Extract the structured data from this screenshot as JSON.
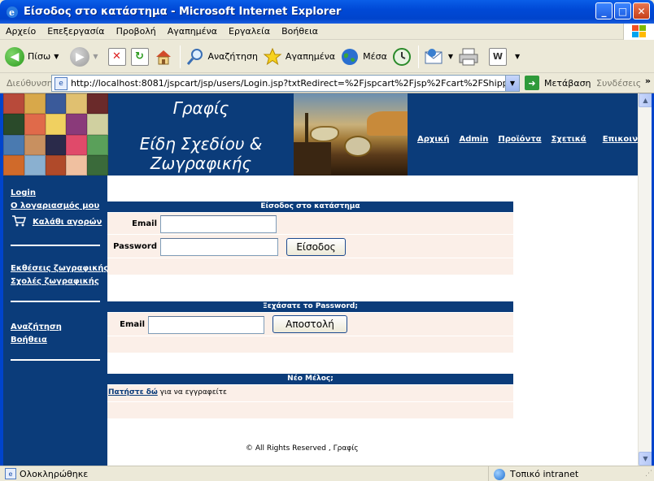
{
  "window": {
    "title": "Είσοδος στο κατάστημα - Microsoft Internet Explorer",
    "minimize": "_",
    "maximize": "□",
    "close": "✕"
  },
  "menu": [
    "Αρχείο",
    "Επεξεργασία",
    "Προβολή",
    "Αγαπημένα",
    "Εργαλεία",
    "Βοήθεια"
  ],
  "toolbar": {
    "back": "Πίσω",
    "search": "Αναζήτηση",
    "favorites": "Αγαπημένα",
    "media": "Μέσα"
  },
  "address": {
    "label": "Διεύθυνση",
    "url": "http://localhost:8081/jspcart/jsp/users/Login.jsp?txtRedirect=%2Fjspcart%2Fjsp%2Fcart%2FShipping.jsp",
    "go": "Μετάβαση",
    "links": "Συνδέσεις",
    "more": "»"
  },
  "header": {
    "brand_name": "Γραφίς",
    "brand_tagline_1": "Είδη Σχεδίου &",
    "brand_tagline_2": "Ζωγραφικής",
    "nav": [
      "Αρχική",
      "Admin",
      "Προϊόντα",
      "Σχετικά",
      "Επικοινωνία"
    ]
  },
  "sidebar": {
    "login": "Login",
    "my_account": "Ο λογαριασμός μου",
    "cart": "Καλάθι αγορών",
    "exhibitions": "Εκθέσεις ζωγραφικής",
    "schools": "Σχολές ζωγραφικής",
    "search": "Αναζήτηση",
    "help": "Βοήθεια"
  },
  "login_panel": {
    "title": "Είσοδος στο κατάστημα",
    "email_label": "Email",
    "password_label": "Password",
    "email_value": "",
    "password_value": "",
    "submit": "Είσοδος"
  },
  "forgot_panel": {
    "title": "Ξεχάσατε το Password;",
    "email_label": "Email",
    "email_value": "",
    "submit": "Αποστολή"
  },
  "register_panel": {
    "title": "Νέο Μέλος;",
    "link": "Πατήστε δώ",
    "rest": " για να εγγραφείτε"
  },
  "footer": "© All Rights Reserved , Γραφίς",
  "status": {
    "text": "Ολοκληρώθηκε",
    "zone": "Τοπικό intranet"
  }
}
